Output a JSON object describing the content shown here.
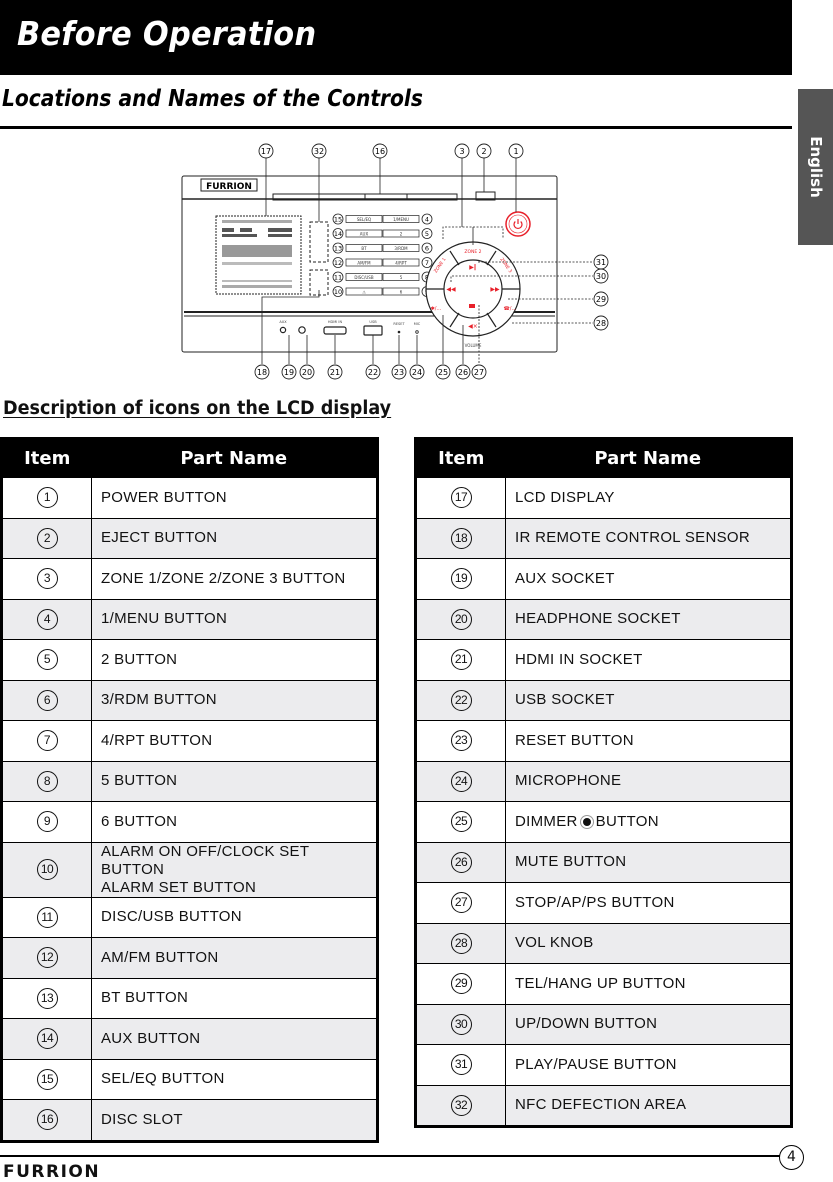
{
  "header": {
    "title": "Before Operation"
  },
  "section": {
    "title": "Locations and Names of the Controls"
  },
  "language_tab": "English",
  "diagram": {
    "brand": "FURRION",
    "callouts_top": [
      "17",
      "32",
      "16",
      "3",
      "2",
      "1"
    ],
    "callouts_right": [
      "31",
      "30",
      "29",
      "28"
    ],
    "callouts_bottom": [
      "18",
      "19",
      "20",
      "21",
      "22",
      "23",
      "24",
      "25",
      "26",
      "27"
    ],
    "button_grid_left_numbers": [
      "15",
      "14",
      "13",
      "12",
      "11",
      "10"
    ],
    "button_grid_right_numbers": [
      "4",
      "5",
      "6",
      "7",
      "8",
      "9"
    ],
    "button_grid_left_labels": [
      "SEL/EQ",
      "AUX",
      "BT",
      "AM/FM",
      "DISC/USB",
      "⚠"
    ],
    "button_grid_right_labels": [
      "1/MENU",
      "2",
      "3/RDM",
      "4/RPT",
      "5",
      "6"
    ],
    "port_labels": [
      "AUX",
      "🎧",
      "HDMI IN",
      "USB",
      "RESET",
      "MIC"
    ],
    "dial_labels": [
      "ZONE 1",
      "ZONE 2",
      "ZONE 3"
    ],
    "volume_label": "VOLUME",
    "accent_color": "#e8202a"
  },
  "lcd_subtitle": "Description of icons on the LCD display",
  "table_headers": {
    "item": "Item",
    "part_name": "Part Name"
  },
  "left_table": [
    {
      "item": "1",
      "name": "POWER BUTTON"
    },
    {
      "item": "2",
      "name": "EJECT BUTTON"
    },
    {
      "item": "3",
      "name": "ZONE 1/ZONE 2/ZONE 3 BUTTON"
    },
    {
      "item": "4",
      "name": "1/MENU BUTTON"
    },
    {
      "item": "5",
      "name": "2 BUTTON"
    },
    {
      "item": "6",
      "name": "3/RDM BUTTON"
    },
    {
      "item": "7",
      "name": "4/RPT BUTTON"
    },
    {
      "item": "8",
      "name": "5 BUTTON"
    },
    {
      "item": "9",
      "name": "6 BUTTON"
    },
    {
      "item": "10",
      "name": "ALARM ON OFF/CLOCK SET BUTTON",
      "name2": "ALARM SET BUTTON"
    },
    {
      "item": "11",
      "name": "DISC/USB BUTTON"
    },
    {
      "item": "12",
      "name": "AM/FM BUTTON"
    },
    {
      "item": "13",
      "name": "BT BUTTON"
    },
    {
      "item": "14",
      "name": "AUX BUTTON"
    },
    {
      "item": "15",
      "name": "SEL/EQ BUTTON"
    },
    {
      "item": "16",
      "name": "DISC SLOT"
    }
  ],
  "right_table": [
    {
      "item": "17",
      "name": "LCD DISPLAY"
    },
    {
      "item": "18",
      "name": "IR REMOTE CONTROL SENSOR"
    },
    {
      "item": "19",
      "name": "AUX SOCKET"
    },
    {
      "item": "20",
      "name": "HEADPHONE SOCKET"
    },
    {
      "item": "21",
      "name": "HDMI IN SOCKET"
    },
    {
      "item": "22",
      "name": "USB SOCKET"
    },
    {
      "item": "23",
      "name": "RESET BUTTON"
    },
    {
      "item": "24",
      "name": "MICROPHONE"
    },
    {
      "item": "25",
      "name": "DIMMER",
      "name_after_icon": "BUTTON",
      "icon": "sun-icon"
    },
    {
      "item": "26",
      "name": "MUTE BUTTON"
    },
    {
      "item": "27",
      "name": "STOP/AP/PS BUTTON"
    },
    {
      "item": "28",
      "name": "VOL KNOB"
    },
    {
      "item": "29",
      "name": "TEL/HANG UP BUTTON"
    },
    {
      "item": "30",
      "name": "UP/DOWN BUTTON"
    },
    {
      "item": "31",
      "name": "PLAY/PAUSE BUTTON"
    },
    {
      "item": "32",
      "name": "NFC DEFECTION AREA"
    }
  ],
  "footer": {
    "page_number": "4",
    "brand": "FURRION"
  }
}
